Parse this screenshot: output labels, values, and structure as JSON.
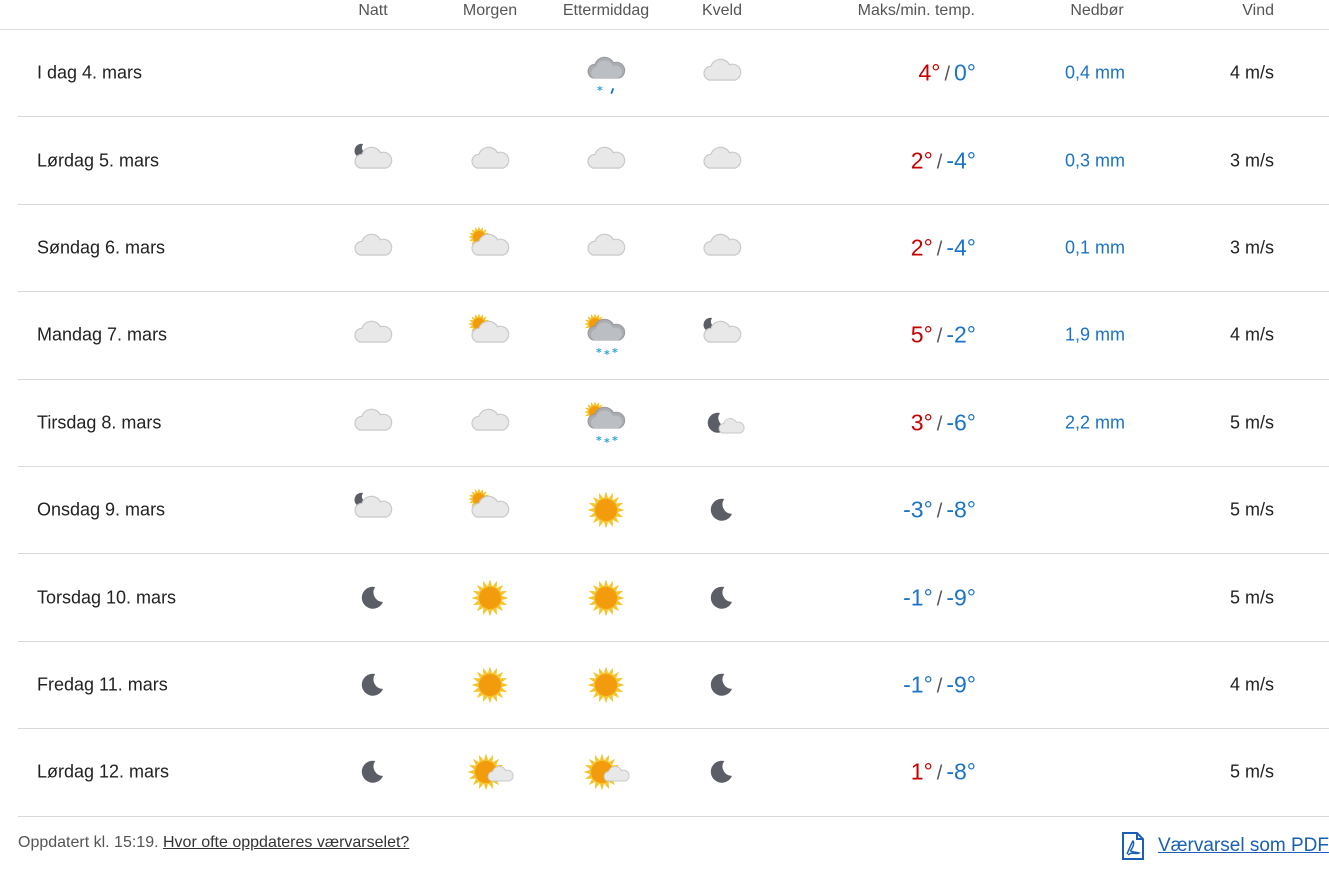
{
  "header": {
    "natt": "Natt",
    "morgen": "Morgen",
    "ettermiddag": "Ettermiddag",
    "kveld": "Kveld",
    "temp": "Maks/min. temp.",
    "nedbor": "Nedbør",
    "vind": "Vind"
  },
  "temp_separator": "/",
  "days": [
    {
      "label": "I dag 4. mars",
      "icons": [
        "",
        "",
        "cloud-sleet",
        "cloud"
      ],
      "max": "4°",
      "max_class": "warm",
      "min": "0°",
      "precip": "0,4 mm",
      "wind": "4 m/s"
    },
    {
      "label": "Lørdag 5. mars",
      "icons": [
        "moon-cloud",
        "cloud",
        "cloud",
        "cloud"
      ],
      "max": "2°",
      "max_class": "warm",
      "min": "-4°",
      "precip": "0,3 mm",
      "wind": "3 m/s"
    },
    {
      "label": "Søndag 6. mars",
      "icons": [
        "cloud",
        "sun-cloud",
        "cloud",
        "cloud"
      ],
      "max": "2°",
      "max_class": "warm",
      "min": "-4°",
      "precip": "0,1 mm",
      "wind": "3 m/s"
    },
    {
      "label": "Mandag 7. mars",
      "icons": [
        "cloud",
        "sun-cloud",
        "sun-cloud-snow",
        "moon-cloud"
      ],
      "max": "5°",
      "max_class": "warm",
      "min": "-2°",
      "precip": "1,9 mm",
      "wind": "4 m/s"
    },
    {
      "label": "Tirsdag 8. mars",
      "icons": [
        "cloud",
        "cloud",
        "sun-cloud-snow",
        "moon-small-cloud"
      ],
      "max": "3°",
      "max_class": "warm",
      "min": "-6°",
      "precip": "2,2 mm",
      "wind": "5 m/s"
    },
    {
      "label": "Onsdag 9. mars",
      "icons": [
        "moon-cloud",
        "sun-cloud",
        "sun",
        "moon"
      ],
      "max": "-3°",
      "max_class": "cold",
      "min": "-8°",
      "precip": "",
      "wind": "5 m/s"
    },
    {
      "label": "Torsdag 10. mars",
      "icons": [
        "moon",
        "sun",
        "sun",
        "moon"
      ],
      "max": "-1°",
      "max_class": "cold",
      "min": "-9°",
      "precip": "",
      "wind": "5 m/s"
    },
    {
      "label": "Fredag 11. mars",
      "icons": [
        "moon",
        "sun",
        "sun",
        "moon"
      ],
      "max": "-1°",
      "max_class": "cold",
      "min": "-9°",
      "precip": "",
      "wind": "4 m/s"
    },
    {
      "label": "Lørdag 12. mars",
      "icons": [
        "moon",
        "sun-small-cloud",
        "sun-small-cloud",
        "moon"
      ],
      "max": "1°",
      "max_class": "warm",
      "min": "-8°",
      "precip": "",
      "wind": "5 m/s"
    }
  ],
  "footer": {
    "updated": "Oppdatert kl. 15:19.",
    "link": "Hvor ofte oppdateres værvarselet?",
    "pdf_label": "Værvarsel som PDF",
    "pdf_icon": "pdf-icon"
  },
  "colors": {
    "warm": "#c60000",
    "cold": "#1a73c7",
    "precip": "#1a73c7",
    "link": "#1a5fb4"
  }
}
